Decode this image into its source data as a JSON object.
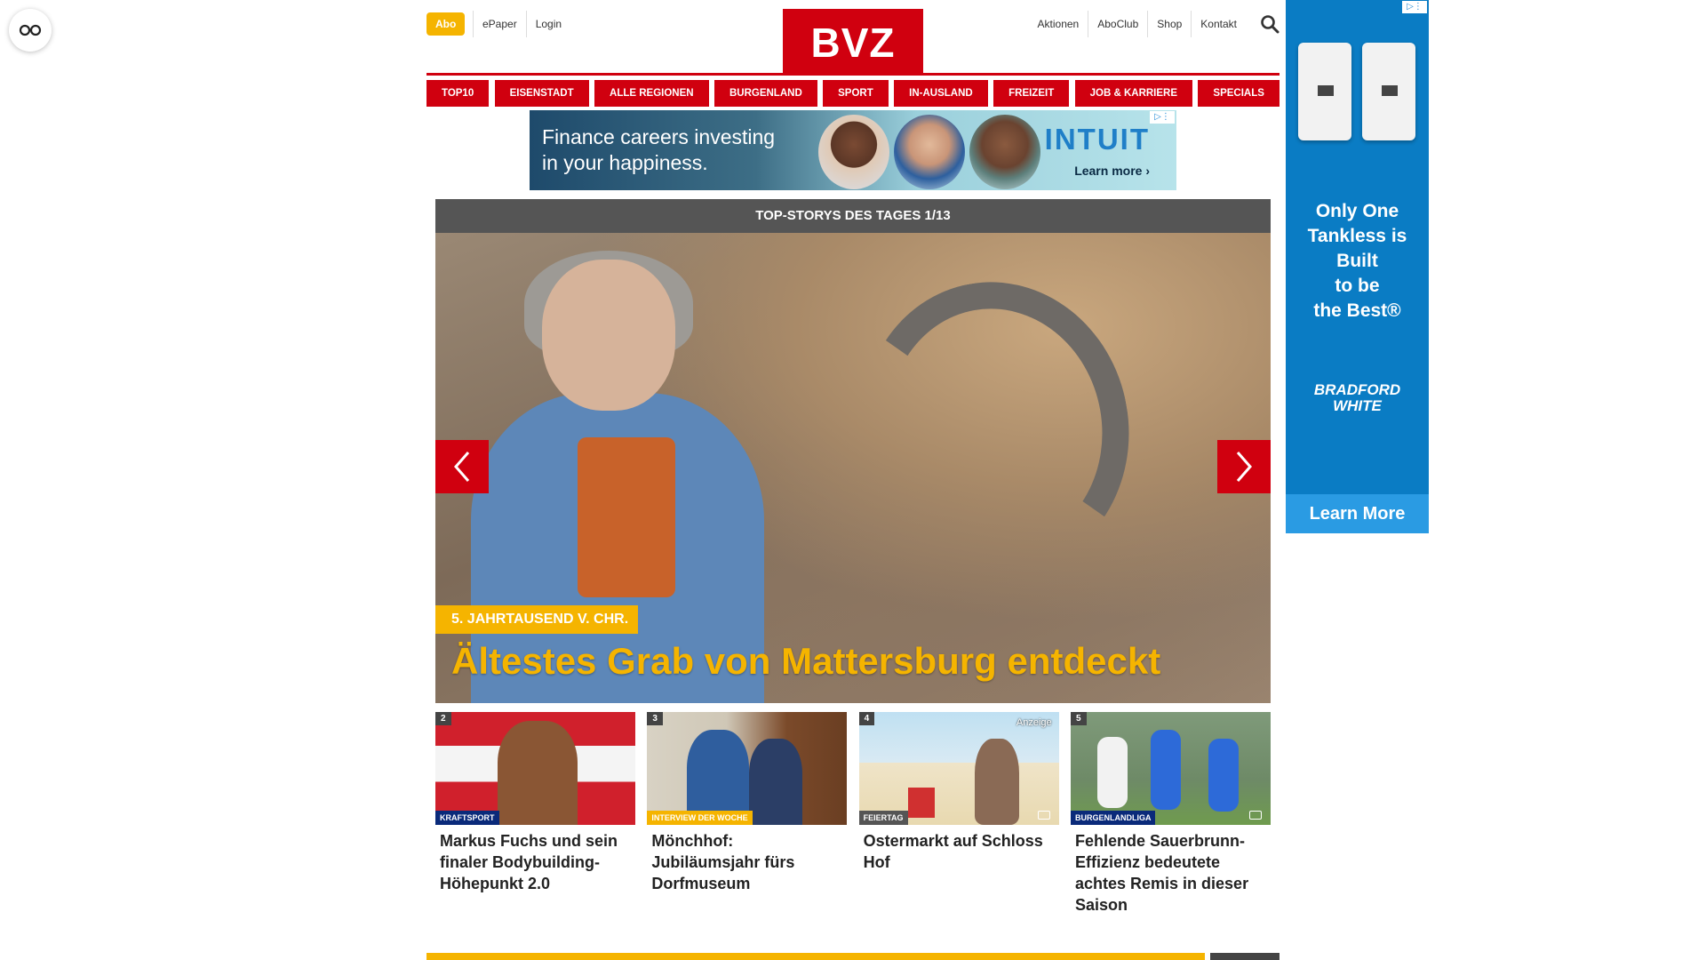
{
  "colors": {
    "brand_red": "#d0000f",
    "accent_yellow": "#f5b400",
    "dark_gray": "#555555"
  },
  "header": {
    "abo_label": "Abo",
    "left_links": [
      "ePaper",
      "Login"
    ],
    "logo_text": "BVZ",
    "right_links": [
      "Aktionen",
      "AboClub",
      "Shop",
      "Kontakt"
    ]
  },
  "nav": {
    "items": [
      "TOP10",
      "EISENSTADT",
      "ALLE REGIONEN",
      "BURGENLAND",
      "SPORT",
      "IN-AUSLAND",
      "FREIZEIT",
      "JOB & KARRIERE",
      "SPECIALS"
    ]
  },
  "banner_ad": {
    "text_line1": "Finance careers investing",
    "text_line2": "in your happiness.",
    "brand": "INTUIT",
    "cta": "Learn more ›"
  },
  "top_story": {
    "header": "TOP-STORYS DES TAGES 1/13",
    "kicker": "5. JAHRTAUSEND V. CHR.",
    "headline": "Ältestes Grab von Mattersburg entdeckt"
  },
  "teasers": [
    {
      "num": "2",
      "label": "KRAFTSPORT",
      "label_color": "#0a2a7a",
      "title": "Markus Fuchs und sein finaler Bodybuilding-Höhepunkt 2.0"
    },
    {
      "num": "3",
      "label": "INTERVIEW DER WOCHE",
      "label_color": "#f5b400",
      "title": "Mönchhof: Jubiläumsjahr fürs Dorfmuseum"
    },
    {
      "num": "4",
      "label": "FEIERTAG",
      "label_color": "#555555",
      "anzeige": "Anzeige",
      "title": "Ostermarkt auf Schloss Hof"
    },
    {
      "num": "5",
      "label": "BURGENLANDLIGA",
      "label_color": "#0a2a7a",
      "title": "Fehlende Sauerbrunn-Effizienz bedeutete achtes Remis in dieser Saison"
    }
  ],
  "sky_ad": {
    "message": [
      "Only One",
      "Tankless is",
      "Built",
      "to be",
      "the Best®"
    ],
    "brand_line1": "BRADFORD",
    "brand_line2": "WHITE",
    "cta": "Learn More"
  },
  "icons": {
    "reader": "glasses-icon",
    "search": "search-icon",
    "prev": "chevron-left-icon",
    "next": "chevron-right-icon",
    "camera": "camera-icon",
    "ad_choices": "ad-choices-icon"
  }
}
